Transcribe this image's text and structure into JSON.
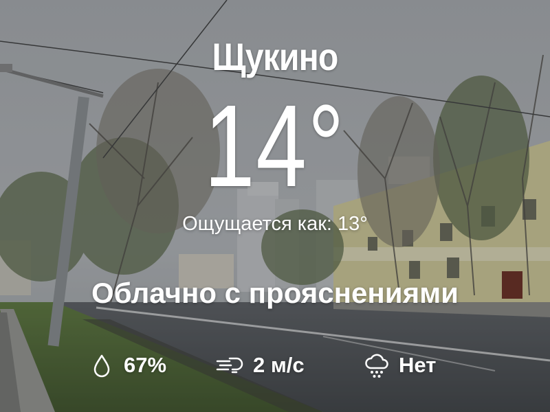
{
  "location": {
    "name": "Щукино"
  },
  "current": {
    "temperature": "14°",
    "feels_like": "Ощущается как: 13°",
    "condition": "Облачно с прояснениями"
  },
  "details": {
    "humidity": {
      "icon": "droplet-icon",
      "value": "67%"
    },
    "wind": {
      "icon": "wind-icon",
      "value": "2 м/с"
    },
    "precipitation": {
      "icon": "rain-cloud-icon",
      "value": "Нет"
    }
  },
  "colors": {
    "text": "#ffffff",
    "sky": "#a9adb1",
    "building": "#d8d19a"
  }
}
